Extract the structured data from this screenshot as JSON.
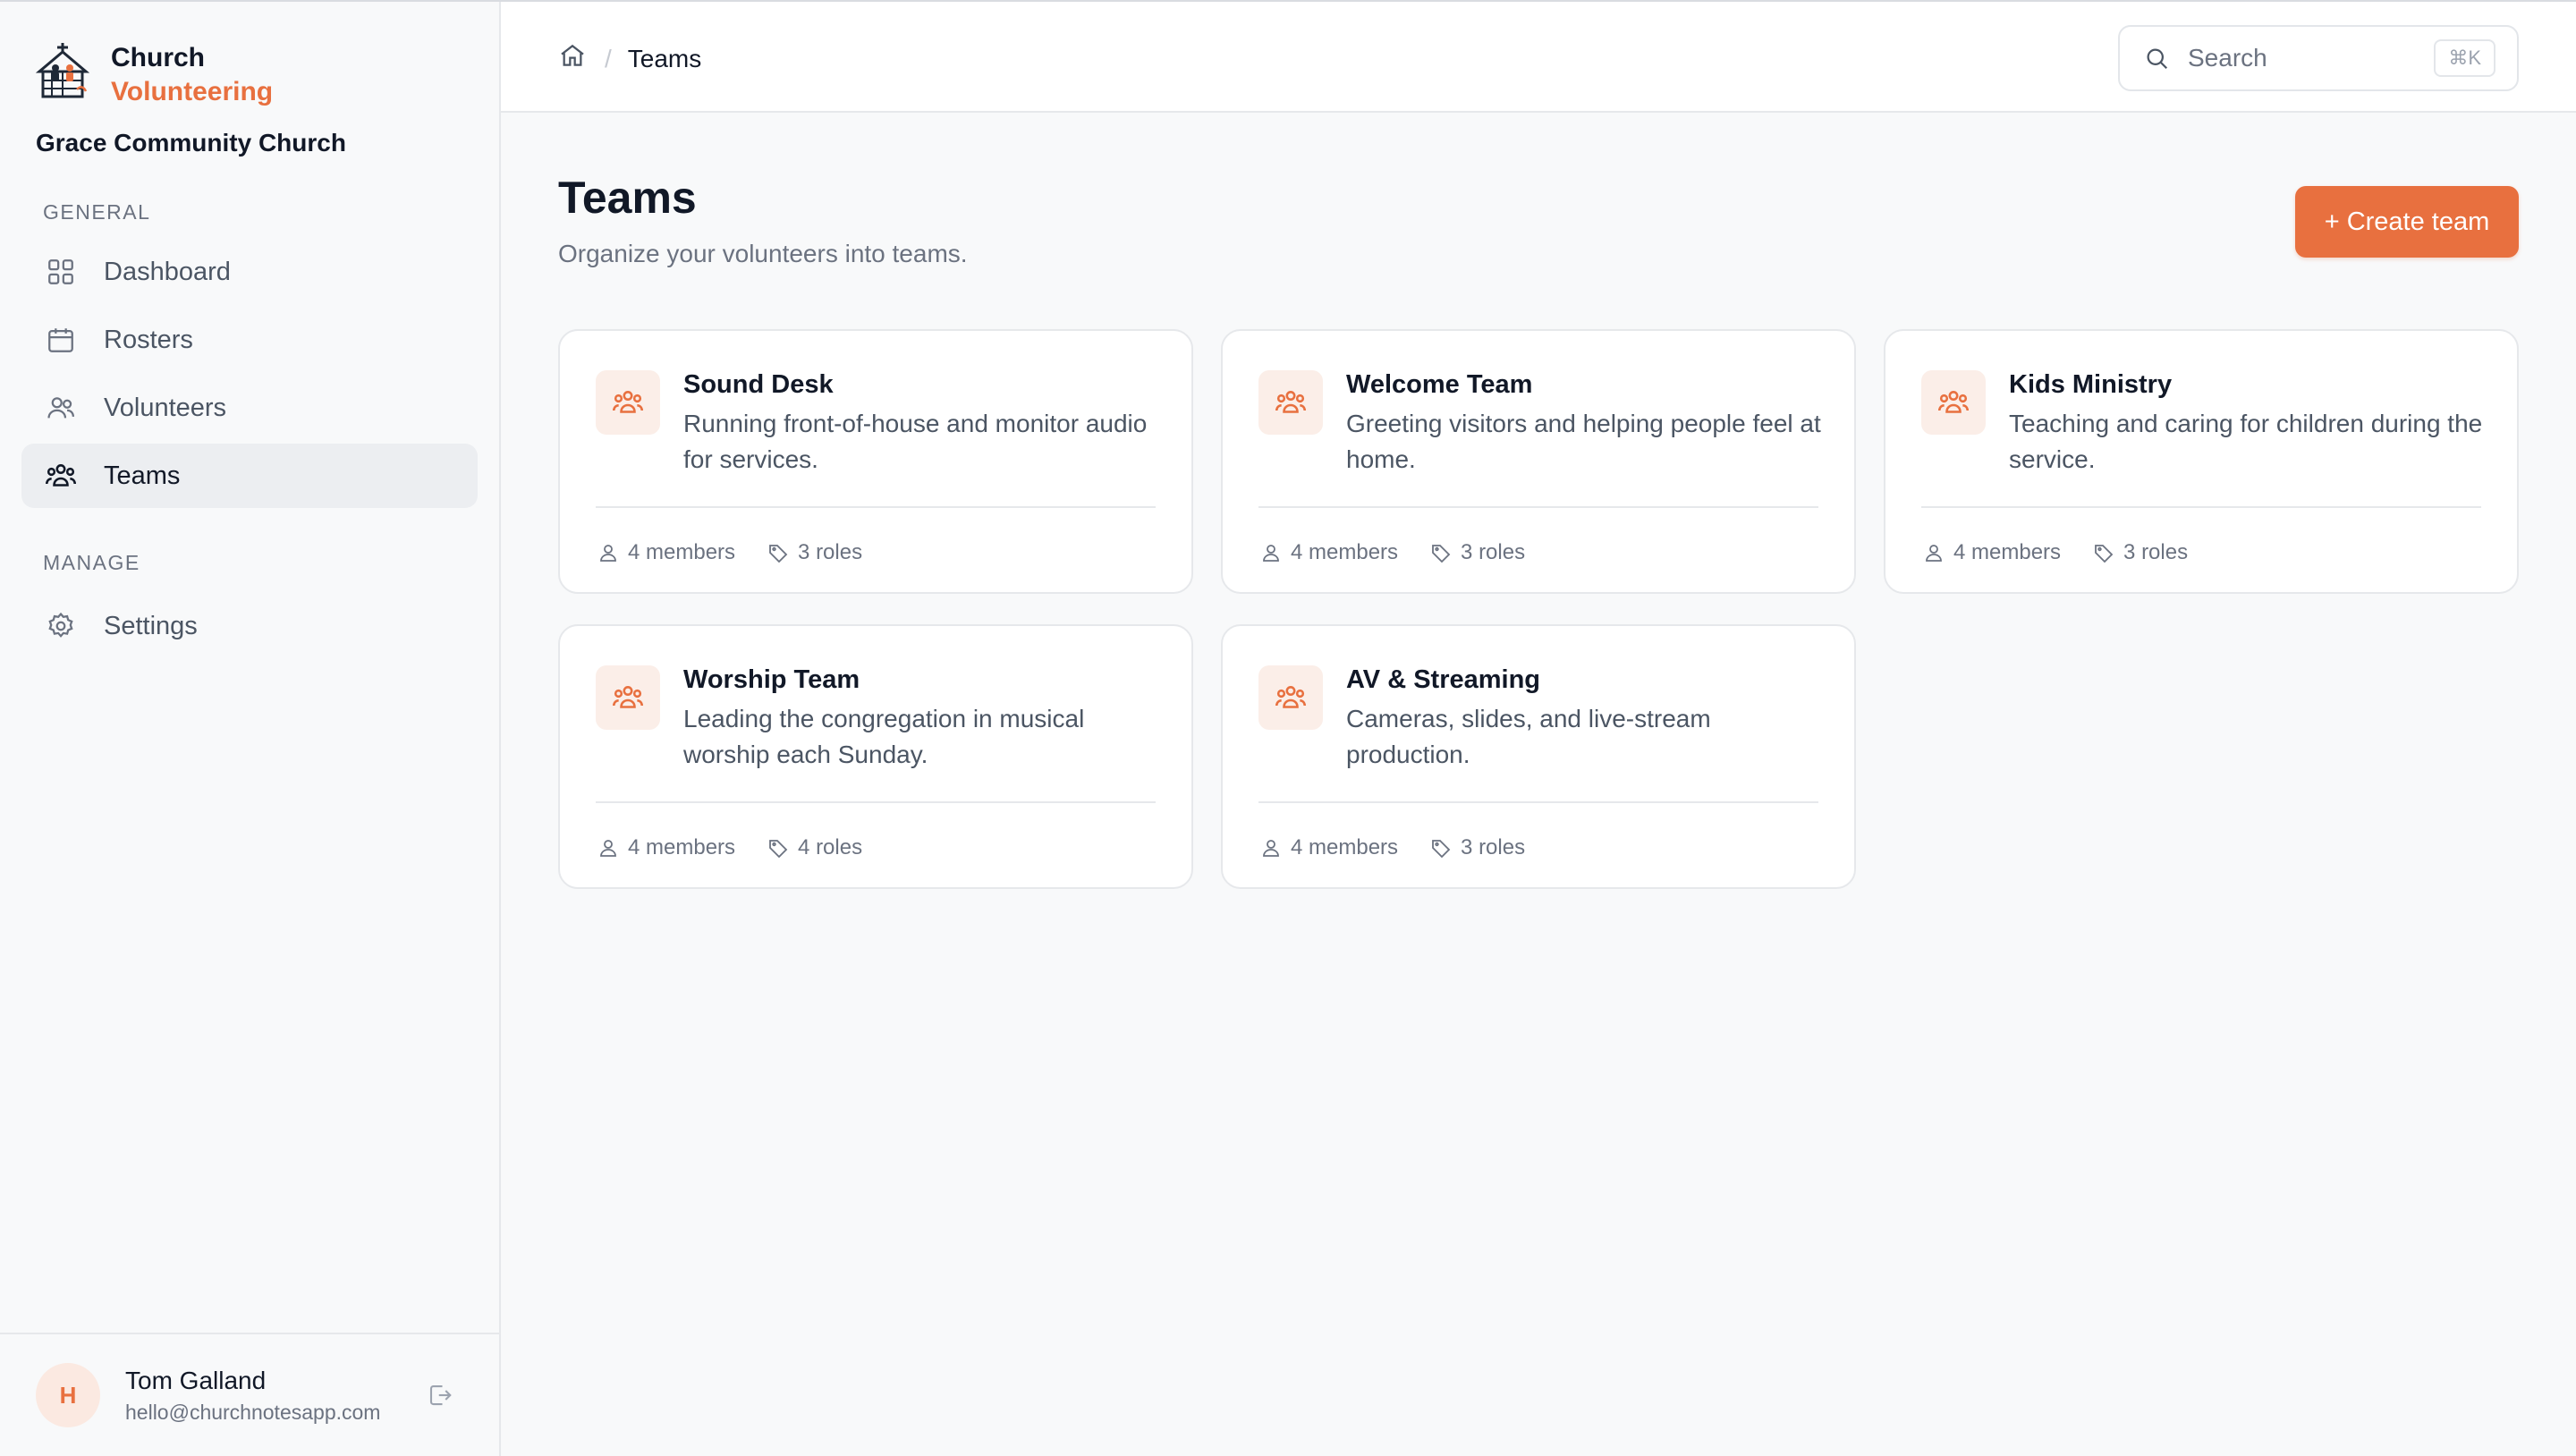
{
  "brand": {
    "line1": "Church",
    "line2": "Volunteering",
    "org": "Grace Community Church"
  },
  "colors": {
    "accent": "#e8703f",
    "accent_soft": "#fbeee8"
  },
  "sidebar": {
    "sections": [
      {
        "label": "General"
      },
      {
        "label": "Manage"
      }
    ],
    "items": [
      {
        "label": "Dashboard",
        "icon": "grid-icon"
      },
      {
        "label": "Rosters",
        "icon": "calendar-icon"
      },
      {
        "label": "Volunteers",
        "icon": "users-icon"
      },
      {
        "label": "Teams",
        "icon": "team-icon",
        "active": true
      },
      {
        "label": "Settings",
        "icon": "gear-icon"
      }
    ]
  },
  "user": {
    "initial": "H",
    "name": "Tom Galland",
    "email": "hello@churchnotesapp.com"
  },
  "topbar": {
    "breadcrumb_current": "Teams",
    "search_placeholder": "Search",
    "search_shortcut": "⌘K"
  },
  "page": {
    "title": "Teams",
    "subtitle": "Organize your volunteers into teams.",
    "create_label": "+ Create team"
  },
  "teams": [
    {
      "name": "Sound Desk",
      "description": "Running front-of-house and monitor audio for services.",
      "members": "4 members",
      "roles": "3 roles"
    },
    {
      "name": "Welcome Team",
      "description": "Greeting visitors and helping people feel at home.",
      "members": "4 members",
      "roles": "3 roles"
    },
    {
      "name": "Kids Ministry",
      "description": "Teaching and caring for children during the service.",
      "members": "4 members",
      "roles": "3 roles"
    },
    {
      "name": "Worship Team",
      "description": "Leading the congregation in musical worship each Sunday.",
      "members": "4 members",
      "roles": "4 roles"
    },
    {
      "name": "AV & Streaming",
      "description": "Cameras, slides, and live-stream production.",
      "members": "4 members",
      "roles": "3 roles"
    }
  ]
}
